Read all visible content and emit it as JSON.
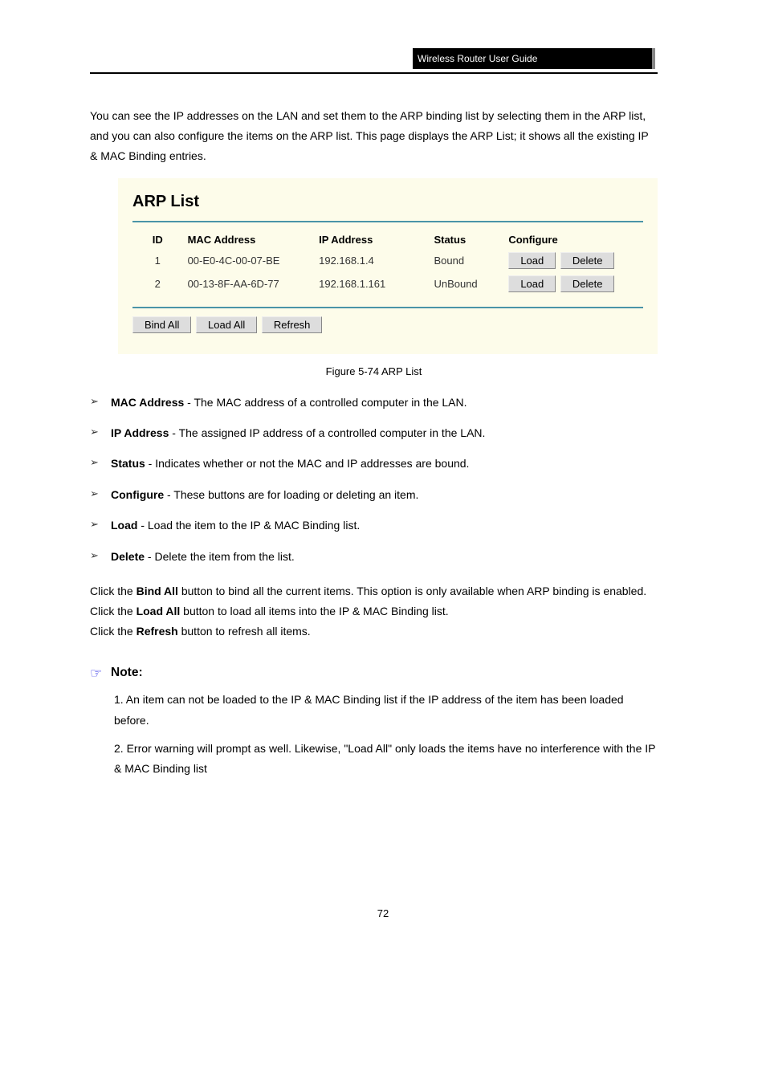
{
  "header_black_bar": "Wireless Router  User Guide",
  "intro_text": "You can see the IP addresses on the LAN and set them to the ARP binding list by selecting them in the ARP list, and you can also configure the items on the ARP list. This page displays the ARP List; it shows all the existing IP & MAC Binding entries.",
  "arp": {
    "title": "ARP List",
    "cols": {
      "id": "ID",
      "mac": "MAC Address",
      "ip": "IP Address",
      "status": "Status",
      "configure": "Configure"
    },
    "rows": [
      {
        "id": "1",
        "mac": "00-E0-4C-00-07-BE",
        "ip": "192.168.1.4",
        "status": "Bound",
        "load": "Load",
        "delete": "Delete"
      },
      {
        "id": "2",
        "mac": "00-13-8F-AA-6D-77",
        "ip": "192.168.1.161",
        "status": "UnBound",
        "load": "Load",
        "delete": "Delete"
      }
    ],
    "buttons": {
      "bind_all": "Bind All",
      "load_all": "Load All",
      "refresh": "Refresh"
    }
  },
  "figure_caption": "Figure 5-74 ARP List",
  "bullets": [
    {
      "label": "MAC Address",
      "text": " - The MAC address of a controlled computer in the LAN."
    },
    {
      "label": "IP Address",
      "text": " - The assigned IP address of a controlled computer in the LAN."
    },
    {
      "label": "Status",
      "text": " - Indicates whether or not the MAC and IP addresses are bound."
    },
    {
      "label": "Configure",
      "text": " - These buttons are for loading or deleting an item."
    },
    {
      "label": "Load",
      "text": " - Load the item to the IP & MAC Binding list."
    },
    {
      "label": "Delete",
      "text": " - Delete the item from the list."
    }
  ],
  "misc_lines": [
    {
      "pre": "Click the ",
      "bold": "Bind All",
      "post": " button to bind all the current items. This option is only available when ARP binding is enabled."
    },
    {
      "pre": "Click the ",
      "bold": "Load All",
      "post": " button to load all items into the IP & MAC Binding list."
    },
    {
      "pre": "Click the ",
      "bold": "Refresh",
      "post": " button to refresh all items."
    }
  ],
  "note": {
    "label": "Note:",
    "p1": "1. An item can not be loaded to the IP & MAC Binding list if the IP address of the item has been loaded before.",
    "p2": "2. Error warning will prompt as well. Likewise, \"Load All\" only loads the items have no interference with the IP & MAC Binding list"
  },
  "page_number": "72"
}
